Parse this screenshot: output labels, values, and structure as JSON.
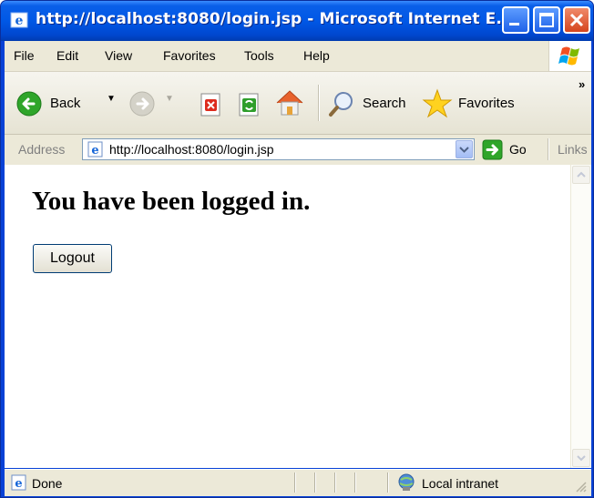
{
  "window": {
    "title": "http://localhost:8080/login.jsp - Microsoft Internet E...",
    "accent": "#0055e5",
    "close_color": "#d5451e"
  },
  "menu": {
    "items": [
      "File",
      "Edit",
      "View",
      "Favorites",
      "Tools",
      "Help"
    ]
  },
  "toolbar": {
    "back_label": "Back",
    "search_label": "Search",
    "favorites_label": "Favorites",
    "overflow_label": "»"
  },
  "address_bar": {
    "label": "Address",
    "url": "http://localhost:8080/login.jsp",
    "go_label": "Go",
    "links_label": "Links"
  },
  "page": {
    "heading": "You have been logged in.",
    "logout_label": "Logout"
  },
  "status_bar": {
    "status": "Done",
    "zone": "Local intranet"
  }
}
